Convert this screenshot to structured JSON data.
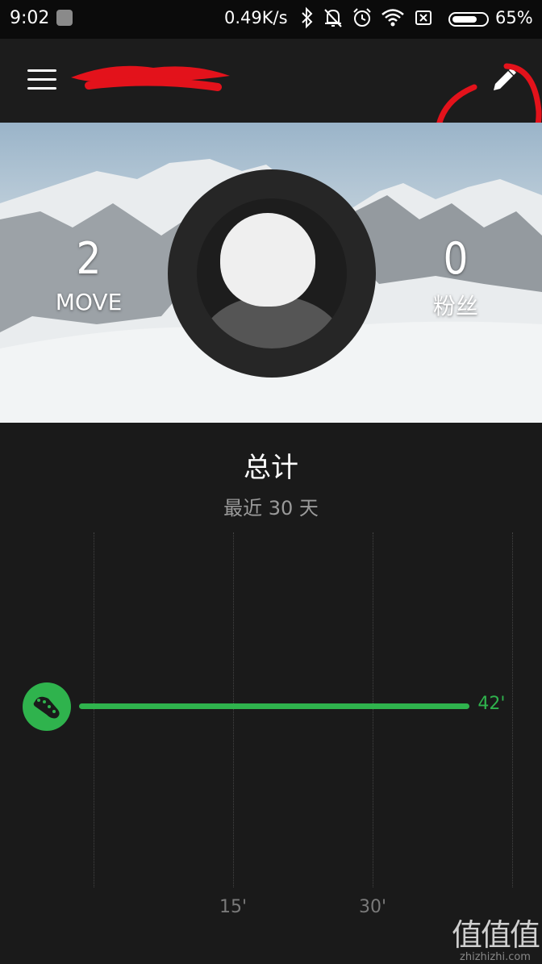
{
  "status_bar": {
    "time": "9:02",
    "speed": "0.49K/s",
    "battery": "65%",
    "icons": [
      "app-icon",
      "bluetooth-icon",
      "bell-off-icon",
      "alarm-icon",
      "wifi-icon",
      "sim-off-icon",
      "battery-icon"
    ]
  },
  "header": {
    "menu_icon": "menu-icon",
    "edit_icon": "pencil-icon"
  },
  "profile": {
    "moves_count": "2",
    "moves_label": "MOVE",
    "followers_count": "0",
    "followers_label": "粉丝"
  },
  "summary": {
    "title": "总计",
    "subtitle": "最近 30 天"
  },
  "chart_data": {
    "type": "bar",
    "orientation": "horizontal",
    "categories": [
      "running"
    ],
    "values": [
      42
    ],
    "value_label": "42'",
    "x_ticks": [
      "15'",
      "30'"
    ],
    "xlim": [
      0,
      45
    ],
    "grid": true,
    "colors": {
      "bar": "#2fb34d"
    }
  },
  "watermark": {
    "top": "值值值",
    "bottom": "zhizhizhi.com"
  }
}
